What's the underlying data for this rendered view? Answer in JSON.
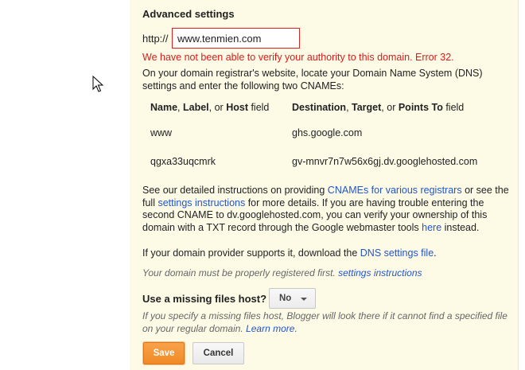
{
  "settings": {
    "heading": "Advanced settings",
    "prefix": "http://",
    "domain_value": "www.tenmien.com",
    "error": "We have not been able to verify your authority to this domain. Error 32.",
    "instructions": "On your domain registrar's website, locate your Domain Name System (DNS) settings and enter the following two CNAMEs:",
    "table": {
      "col1": {
        "b1": "Name",
        "sep1": ", ",
        "b2": "Label",
        "sep2": ", or ",
        "b3": "Host",
        "tail": " field"
      },
      "col2": {
        "b1": "Destination",
        "sep1": ", ",
        "b2": "Target",
        "sep2": ", or ",
        "b3": "Points To",
        "tail": " field"
      },
      "rows": [
        {
          "name": "www",
          "dest": "ghs.google.com"
        },
        {
          "name": "qgxa33uqcmrk",
          "dest": "gv-mnvr7n7w56x6gj.dv.googlehosted.com"
        }
      ]
    },
    "detail": {
      "t1": "See our detailed instructions on providing ",
      "l1": "CNAMEs for various registrars",
      "t2": " or see the full ",
      "l2": "settings instructions",
      "t3": " for more details. If you are having trouble entering the second CNAME to dv.googlehosted.com, you can verify your ownership of this domain with a TXT record through the Google webmaster tools ",
      "l3": "here",
      "t4": " instead."
    },
    "dns_line": {
      "t1": "If your domain provider supports it, download the ",
      "l1": "DNS settings file",
      "t2": "."
    },
    "note": {
      "t1": "Your domain must be properly registered first. ",
      "l1": "settings instructions"
    },
    "missing_host_label": "Use a missing files host?",
    "missing_host_value": "No",
    "missing_help": {
      "t1": "If you specify a missing files host, Blogger will look there if it cannot find a specified file on your regular domain. ",
      "l1": "Learn more."
    },
    "save_label": "Save",
    "cancel_label": "Cancel"
  },
  "colors": {
    "panel_bg": "#fdfbe6",
    "error": "#dd1a1a",
    "link": "#2255cc",
    "save_bg": "#f08a24"
  },
  "icons": {
    "cursor": "mouse-pointer-icon",
    "dropdown": "chevron-down-icon"
  }
}
